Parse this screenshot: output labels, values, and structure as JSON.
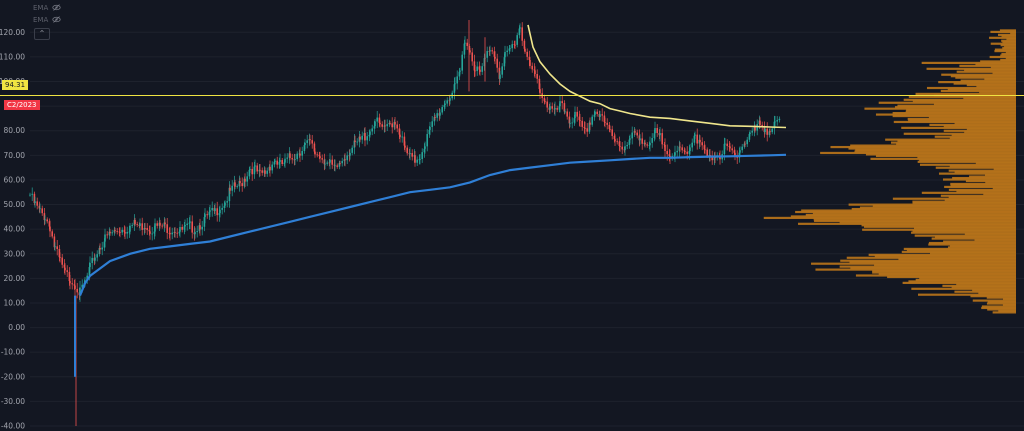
{
  "legend": [
    {
      "label": "EMA",
      "icon": "eye-icon"
    },
    {
      "label": "EMA",
      "icon": "eye-icon"
    }
  ],
  "collapse_icon": "chevron-up-icon",
  "price_badge": "94.31",
  "date_badge": "C2/2023",
  "colors": {
    "background": "#131722",
    "up": "#26a69a",
    "down": "#ef5350",
    "ema_long": "#2f7fd6",
    "ema_short": "#f0e68c",
    "price_line": "#f0e442",
    "volume_profile": "#b8741a",
    "axis_text": "#a3a6af"
  },
  "chart_data": {
    "type": "candlestick",
    "ylim": [
      -40,
      125
    ],
    "y_ticks": [
      "120.00",
      "110.00",
      "100.00",
      "90.00",
      "80.00",
      "70.00",
      "60.00",
      "50.00",
      "40.00",
      "30.00",
      "20.00",
      "10.00",
      "0.00",
      "-10.00",
      "-20.00",
      "-30.00",
      "-40.00"
    ],
    "horizontal_line": 94.31,
    "series": [
      {
        "kind": "ohlc_approx",
        "points": [
          [
            0,
            54
          ],
          [
            5,
            50
          ],
          [
            10,
            47
          ],
          [
            15,
            45
          ],
          [
            20,
            41
          ],
          [
            25,
            32
          ],
          [
            30,
            27
          ],
          [
            35,
            22
          ],
          [
            40,
            20
          ],
          [
            45,
            18
          ],
          [
            50,
            14
          ],
          [
            55,
            18
          ],
          [
            60,
            24
          ],
          [
            65,
            29
          ],
          [
            70,
            33
          ],
          [
            75,
            36
          ],
          [
            80,
            38
          ],
          [
            85,
            39
          ],
          [
            90,
            40
          ],
          [
            95,
            40
          ],
          [
            100,
            41
          ],
          [
            105,
            42
          ],
          [
            110,
            41
          ],
          [
            115,
            42
          ],
          [
            120,
            40
          ],
          [
            125,
            41
          ],
          [
            130,
            41
          ],
          [
            135,
            41
          ],
          [
            140,
            40
          ],
          [
            145,
            40
          ],
          [
            150,
            39
          ],
          [
            155,
            40
          ],
          [
            160,
            41
          ],
          [
            165,
            40
          ],
          [
            170,
            42
          ],
          [
            175,
            44
          ],
          [
            180,
            46
          ],
          [
            185,
            47
          ],
          [
            190,
            49
          ],
          [
            195,
            51
          ],
          [
            200,
            55
          ],
          [
            205,
            57
          ],
          [
            210,
            58
          ],
          [
            215,
            61
          ],
          [
            220,
            65
          ],
          [
            225,
            64
          ],
          [
            230,
            62
          ],
          [
            235,
            63
          ],
          [
            240,
            66
          ],
          [
            245,
            68
          ],
          [
            250,
            66
          ],
          [
            255,
            67
          ],
          [
            260,
            69
          ],
          [
            265,
            70
          ],
          [
            270,
            72
          ],
          [
            275,
            74
          ],
          [
            280,
            75
          ],
          [
            285,
            71
          ],
          [
            290,
            70
          ],
          [
            295,
            68
          ],
          [
            300,
            66
          ],
          [
            305,
            64
          ],
          [
            310,
            67
          ],
          [
            315,
            70
          ],
          [
            320,
            72
          ],
          [
            325,
            74
          ],
          [
            330,
            76
          ],
          [
            335,
            78
          ],
          [
            340,
            80
          ],
          [
            345,
            84
          ],
          [
            350,
            82
          ],
          [
            355,
            80
          ],
          [
            360,
            83
          ],
          [
            365,
            84
          ],
          [
            370,
            79
          ],
          [
            375,
            72
          ],
          [
            380,
            69
          ],
          [
            385,
            68
          ],
          [
            390,
            70
          ],
          [
            395,
            75
          ],
          [
            400,
            80
          ],
          [
            405,
            85
          ],
          [
            410,
            88
          ],
          [
            415,
            92
          ],
          [
            420,
            94
          ],
          [
            425,
            97
          ],
          [
            430,
            104
          ],
          [
            435,
            118
          ],
          [
            440,
            112
          ],
          [
            445,
            106
          ],
          [
            450,
            103
          ],
          [
            455,
            109
          ],
          [
            460,
            114
          ],
          [
            465,
            111
          ],
          [
            470,
            102
          ],
          [
            475,
            110
          ],
          [
            480,
            113
          ],
          [
            485,
            116
          ],
          [
            490,
            123
          ],
          [
            495,
            112
          ],
          [
            500,
            106
          ],
          [
            505,
            102
          ],
          [
            510,
            97
          ],
          [
            515,
            92
          ],
          [
            520,
            89
          ],
          [
            525,
            87
          ],
          [
            530,
            90
          ],
          [
            535,
            88
          ],
          [
            540,
            84
          ],
          [
            545,
            86
          ],
          [
            550,
            82
          ],
          [
            555,
            79
          ],
          [
            560,
            84
          ],
          [
            565,
            88
          ],
          [
            570,
            86
          ],
          [
            575,
            82
          ],
          [
            580,
            80
          ],
          [
            585,
            77
          ],
          [
            590,
            75
          ],
          [
            595,
            72
          ],
          [
            600,
            76
          ],
          [
            605,
            79
          ],
          [
            610,
            78
          ],
          [
            615,
            75
          ],
          [
            620,
            73
          ],
          [
            625,
            79
          ],
          [
            630,
            77
          ],
          [
            635,
            74
          ],
          [
            640,
            71
          ],
          [
            645,
            69
          ],
          [
            650,
            72
          ],
          [
            655,
            71
          ],
          [
            660,
            74
          ],
          [
            665,
            79
          ],
          [
            670,
            74
          ],
          [
            675,
            71
          ],
          [
            680,
            68
          ],
          [
            685,
            71
          ],
          [
            690,
            70
          ],
          [
            695,
            73
          ],
          [
            700,
            72
          ],
          [
            705,
            70
          ],
          [
            710,
            73
          ],
          [
            715,
            75
          ],
          [
            720,
            79
          ],
          [
            725,
            80
          ],
          [
            730,
            83
          ],
          [
            735,
            81
          ],
          [
            740,
            80
          ],
          [
            745,
            82
          ],
          [
            750,
            85
          ]
        ]
      },
      {
        "name": "EMA",
        "kind": "line",
        "points": [
          [
            50,
            13
          ],
          [
            55,
            18
          ],
          [
            60,
            21
          ],
          [
            70,
            24
          ],
          [
            80,
            27
          ],
          [
            100,
            30
          ],
          [
            120,
            32
          ],
          [
            140,
            33
          ],
          [
            160,
            34
          ],
          [
            180,
            35
          ],
          [
            200,
            37
          ],
          [
            220,
            39
          ],
          [
            240,
            41
          ],
          [
            260,
            43
          ],
          [
            280,
            45
          ],
          [
            300,
            47
          ],
          [
            320,
            49
          ],
          [
            340,
            51
          ],
          [
            360,
            53
          ],
          [
            380,
            55
          ],
          [
            400,
            56
          ],
          [
            420,
            57
          ],
          [
            440,
            59
          ],
          [
            460,
            62
          ],
          [
            480,
            64
          ],
          [
            500,
            65
          ],
          [
            520,
            66
          ],
          [
            540,
            67
          ],
          [
            560,
            67.5
          ],
          [
            580,
            68
          ],
          [
            600,
            68.5
          ],
          [
            620,
            69
          ],
          [
            640,
            69
          ],
          [
            660,
            69.3
          ],
          [
            680,
            69.5
          ],
          [
            700,
            69.6
          ],
          [
            720,
            69.8
          ],
          [
            740,
            70
          ],
          [
            756,
            70.2
          ]
        ]
      },
      {
        "name": "EMA",
        "kind": "line",
        "points": [
          [
            498,
            123
          ],
          [
            503,
            114
          ],
          [
            510,
            108
          ],
          [
            520,
            103
          ],
          [
            530,
            99
          ],
          [
            540,
            96
          ],
          [
            550,
            94
          ],
          [
            560,
            92
          ],
          [
            570,
            91
          ],
          [
            580,
            89
          ],
          [
            590,
            88
          ],
          [
            600,
            87
          ],
          [
            620,
            85.5
          ],
          [
            640,
            85
          ],
          [
            660,
            84
          ],
          [
            680,
            83
          ],
          [
            700,
            82
          ],
          [
            720,
            81.8
          ],
          [
            740,
            81.5
          ],
          [
            756,
            81.3
          ]
        ]
      }
    ],
    "volume_profile_from": 6
  }
}
